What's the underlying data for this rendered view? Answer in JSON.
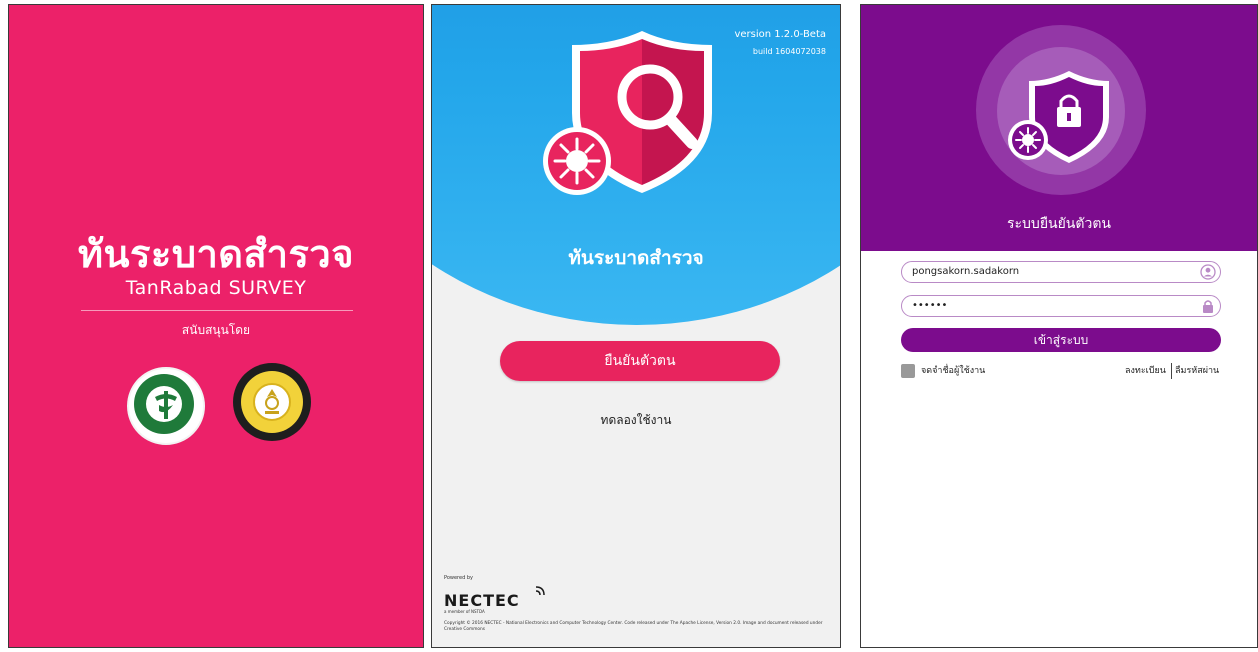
{
  "splash": {
    "app_title": "ทันระบาดสำรวจ",
    "app_subtitle": "TanRabad SURVEY",
    "sponsor_label": "สนับสนุนโดย",
    "background_color": "#ec2169"
  },
  "welcome": {
    "version": "version 1.2.0-Beta",
    "build": "build 1604072038",
    "app_title": "ทันระบาดสำรวจ",
    "verify_button": "ยืนยันตัวตน",
    "trial_link": "ทดลองใช้งาน",
    "powered_by": "Powered by",
    "nectec_logo": "NECTEC",
    "nectec_member": "a member of NSTDA",
    "copyright": "Copyright © 2016 NECTEC - National Electronics and Computer Technology Center. Code released under The Apache License, Version 2.0. Image and document released under Creative Commons",
    "accent_color": "#e8245e",
    "hero_color": "#1a8ee0"
  },
  "login": {
    "title": "ระบบยืนยันตัวตน",
    "username_value": "pongsakorn.sadakorn",
    "password_value": "••••••",
    "login_button": "เข้าสู่ระบบ",
    "remember_label": "จดจำชื่อผู้ใช้งาน",
    "register_link": "ลงทะเบียน",
    "forgot_link": "ลืมรหัสผ่าน",
    "header_color": "#7c0c8d"
  }
}
